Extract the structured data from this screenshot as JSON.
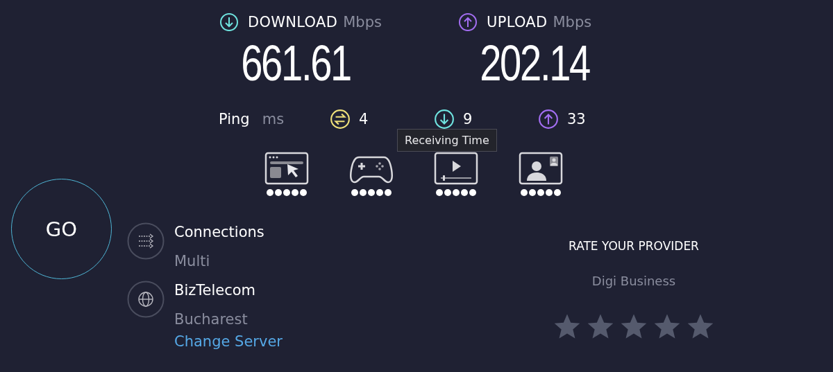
{
  "results": [
    {
      "kind": "download",
      "label": "DOWNLOAD",
      "unit": "Mbps",
      "value": "661.61"
    },
    {
      "kind": "upload",
      "label": "UPLOAD",
      "unit": "Mbps",
      "value": "202.14"
    }
  ],
  "ping": {
    "label": "Ping",
    "unit": "ms",
    "readings": [
      {
        "kind": "idle",
        "value": "4"
      },
      {
        "kind": "download",
        "value": "9"
      },
      {
        "kind": "upload",
        "value": "33"
      }
    ]
  },
  "tooltip": "Receiving Time",
  "activities": [
    {
      "kind": "browsing",
      "stars": 5
    },
    {
      "kind": "gaming",
      "stars": 5
    },
    {
      "kind": "streaming",
      "stars": 5
    },
    {
      "kind": "video_call",
      "stars": 5
    }
  ],
  "go_button": "GO",
  "server_info": [
    {
      "kind": "connections",
      "title": "Connections",
      "subtitle": "Multi"
    },
    {
      "kind": "server",
      "title": "BizTelecom",
      "subtitle": "Bucharest",
      "link": "Change Server"
    }
  ],
  "rating": {
    "title": "RATE YOUR PROVIDER",
    "provider": "Digi Business"
  }
}
